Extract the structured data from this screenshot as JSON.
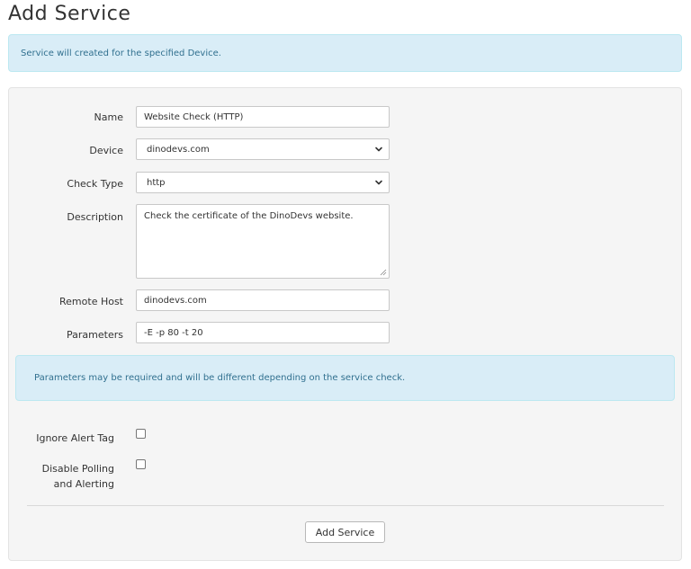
{
  "page": {
    "title": "Add Service"
  },
  "info_alert": {
    "text": "Service will created for the specified Device."
  },
  "form": {
    "name": {
      "label": "Name",
      "value": "Website Check (HTTP)"
    },
    "device": {
      "label": "Device",
      "selected": "dinodevs.com"
    },
    "check_type": {
      "label": "Check Type",
      "selected": "http"
    },
    "description": {
      "label": "Description",
      "value": "Check the certificate of the DinoDevs website."
    },
    "remote_host": {
      "label": "Remote Host",
      "value": "dinodevs.com"
    },
    "parameters": {
      "label": "Parameters",
      "value": "-E -p 80 -t 20"
    },
    "parameters_help": "Parameters may be required and will be different depending on the service check.",
    "ignore_alert_tag": {
      "label": "Ignore Alert Tag",
      "checked": false
    },
    "disable_polling": {
      "label_line1": "Disable Polling",
      "label_line2": "and Alerting",
      "checked": false
    },
    "submit_label": "Add Service"
  },
  "icons": {
    "select_arrow": "chevron-down-icon",
    "resize": "resize-handle-icon"
  },
  "colors": {
    "alert_bg": "#d9edf7",
    "alert_text": "#31708f",
    "well_bg": "#f5f5f5"
  }
}
